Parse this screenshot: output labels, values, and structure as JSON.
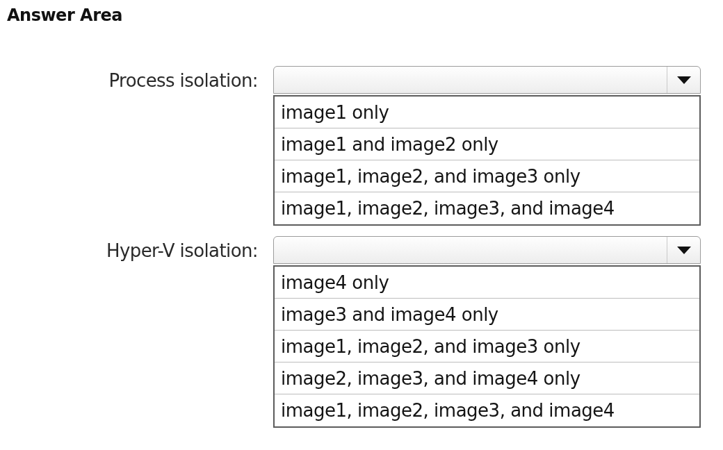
{
  "title": "Answer Area",
  "questions": [
    {
      "label": "Process isolation:",
      "dropdown": {
        "expanded": true,
        "options": [
          {
            "label": "image1 only",
            "selected": false
          },
          {
            "label": "image1 and image2 only",
            "selected": false
          },
          {
            "label": "image1, image2, and image3 only",
            "selected": false
          },
          {
            "label": "image1, image2, image3, and image4",
            "selected": false
          }
        ]
      }
    },
    {
      "label": "Hyper-V isolation:",
      "dropdown": {
        "expanded": true,
        "options": [
          {
            "label": "image4 only",
            "selected": false
          },
          {
            "label": "image3 and image4 only",
            "selected": false
          },
          {
            "label": "image1, image2, and image3 only",
            "selected": false
          },
          {
            "label": "image2, image3, and image4 only",
            "selected": false
          },
          {
            "label": "image1, image2, image3, and image4",
            "selected": false
          }
        ]
      }
    }
  ]
}
